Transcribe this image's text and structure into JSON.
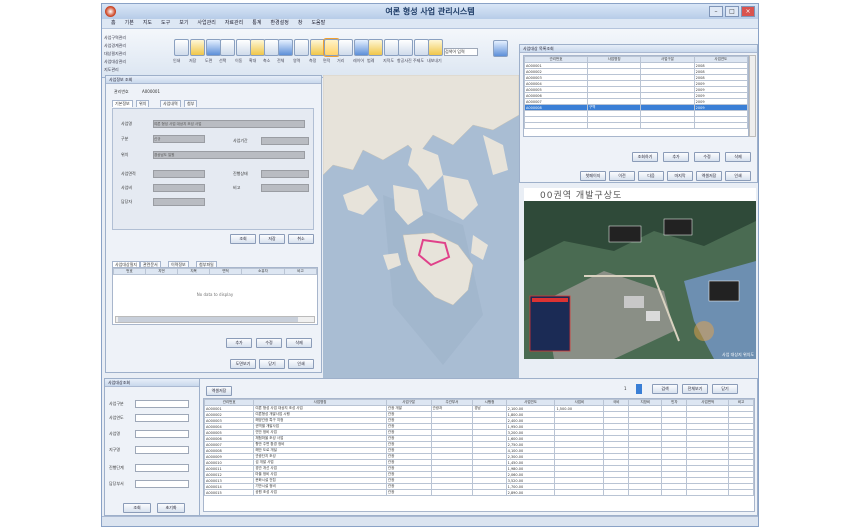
{
  "window": {
    "title": "여론 형성 사업 관리시스템"
  },
  "menu": [
    "홈",
    "기본",
    "지도",
    "도구",
    "보기",
    "사업관리",
    "자료관리",
    "통계",
    "환경설정",
    "창",
    "도움말"
  ],
  "ribbon": {
    "left_items": [
      "사업구역관리",
      "사업경계관리",
      "대상필지관리",
      "사업대상관리",
      "지도관리"
    ],
    "search_box_value": "검색어 입력",
    "icon_labels": [
      "인쇄",
      "저장",
      "도면",
      "선택",
      "이동",
      "확대",
      "축소",
      "전체",
      "영역",
      "측정",
      "면적",
      "거리",
      "레이어",
      "범례",
      "지적도",
      "항공사진",
      "주제도",
      "내보내기"
    ]
  },
  "left_panel": {
    "header": "사업정보 조회",
    "code_label": "관리번호",
    "code_value": "A000001",
    "tabs": [
      "기본정보",
      "위치",
      "사업내역",
      "첨부"
    ],
    "fields": [
      {
        "label": "사업명",
        "value": "여론 형성 사업 대상지 조성 사업"
      },
      {
        "label": "구분",
        "value": "신규"
      },
      {
        "label": "위치",
        "value": "경상남도 일원"
      },
      {
        "label": "사업면적",
        "value": ""
      },
      {
        "label": "사업비",
        "value": ""
      },
      {
        "label": "담당자",
        "value": ""
      }
    ],
    "side_labels": [
      "사업기간",
      "진행상태",
      "비고"
    ],
    "buttons": [
      "조회",
      "저장",
      "취소"
    ],
    "list_tabs": [
      "사업대상필지",
      "관련문서",
      "이력정보",
      "첨부파일"
    ],
    "list_columns": [
      "번호",
      "지번",
      "지목",
      "면적",
      "소유자",
      "비고"
    ],
    "empty_text": "No data to display",
    "list_buttons": [
      "추가",
      "수정",
      "삭제"
    ],
    "bottom_buttons": [
      "도면보기",
      "닫기",
      "인쇄"
    ]
  },
  "right_panel": {
    "header": "사업대상 목록조회",
    "columns": [
      "관리번호",
      "사업명칭",
      "사업구분",
      "사업연도"
    ],
    "rows": [
      [
        "A000001",
        "",
        "",
        "2008"
      ],
      [
        "A000002",
        "",
        "",
        "2008"
      ],
      [
        "A000003",
        "",
        "",
        "2008"
      ],
      [
        "A000004",
        "",
        "",
        "2009"
      ],
      [
        "A000005",
        "",
        "",
        "2009"
      ],
      [
        "A000006",
        "",
        "",
        "2009"
      ],
      [
        "A000007",
        "",
        "",
        "2009"
      ],
      [
        "A000008",
        "구역",
        "",
        "2009"
      ]
    ],
    "selected_row": 7,
    "buttons1": [
      "조회하기",
      "추가",
      "수정",
      "삭제"
    ],
    "buttons2": [
      "첫페이지",
      "이전",
      "다음",
      "마지막",
      "엑셀저장",
      "인쇄"
    ],
    "slogan": "00권역 개발구상도",
    "caption": "사업 대상지 위치도"
  },
  "bottom": {
    "panel_header": "사업대상조회",
    "form_labels": [
      "사업구분",
      "사업연도",
      "사업명",
      "지구명",
      "진행단계",
      "담당부서"
    ],
    "form_buttons": [
      "조회",
      "초기화"
    ],
    "toolbar_button": "엑셀저장",
    "right_buttons": [
      "검색",
      "전체보기",
      "닫기"
    ],
    "page_number": "1",
    "columns": [
      "관리번호",
      "사업명칭",
      "사업구분",
      "주관부서",
      "시행청",
      "사업연도",
      "사업비",
      "국비",
      "지방비",
      "민자",
      "사업면적",
      "비고"
    ],
    "rows": [
      [
        "A000001",
        "여론 형성 사업 대상지 조성 사업",
        "관광 개발",
        "관광과",
        "경남",
        "2,100.00",
        "1,500.00",
        "",
        "",
        "",
        "",
        ""
      ],
      [
        "A000002",
        "여론형성 개발사업 시행",
        "관광",
        "",
        "",
        "1,800.00",
        "",
        "",
        "",
        "",
        "",
        ""
      ],
      [
        "A000003",
        "해양관광 특구 지정",
        "관광",
        "",
        "",
        "2,400.00",
        "",
        "",
        "",
        "",
        "",
        ""
      ],
      [
        "A000004",
        "권역별 개발사업",
        "관광",
        "",
        "",
        "1,950.00",
        "",
        "",
        "",
        "",
        "",
        ""
      ],
      [
        "A000005",
        "연안 정비 사업",
        "관광",
        "",
        "",
        "3,200.00",
        "",
        "",
        "",
        "",
        "",
        ""
      ],
      [
        "A000006",
        "체험마을 조성 사업",
        "관광",
        "",
        "",
        "1,600.00",
        "",
        "",
        "",
        "",
        "",
        ""
      ],
      [
        "A000007",
        "항만 주변 환경 정비",
        "관광",
        "",
        "",
        "2,750.00",
        "",
        "",
        "",
        "",
        "",
        ""
      ],
      [
        "A000008",
        "해안 도로 개설",
        "관광",
        "",
        "",
        "4,100.00",
        "",
        "",
        "",
        "",
        "",
        ""
      ],
      [
        "A000009",
        "관광단지 조성",
        "관광",
        "",
        "",
        "2,300.00",
        "",
        "",
        "",
        "",
        "",
        ""
      ],
      [
        "A000010",
        "섬 개발 사업",
        "관광",
        "",
        "",
        "1,450.00",
        "",
        "",
        "",
        "",
        "",
        ""
      ],
      [
        "A000011",
        "경관 개선 사업",
        "관광",
        "",
        "",
        "1,980.00",
        "",
        "",
        "",
        "",
        "",
        ""
      ],
      [
        "A000012",
        "마을 정비 사업",
        "관광",
        "",
        "",
        "2,060.00",
        "",
        "",
        "",
        "",
        "",
        ""
      ],
      [
        "A000013",
        "문화시설 건립",
        "관광",
        "",
        "",
        "3,520.00",
        "",
        "",
        "",
        "",
        "",
        ""
      ],
      [
        "A000014",
        "기반시설 정비",
        "관광",
        "",
        "",
        "1,700.00",
        "",
        "",
        "",
        "",
        "",
        ""
      ],
      [
        "A000015",
        "공원 조성 사업",
        "관광",
        "",
        "",
        "2,890.00",
        "",
        "",
        "",
        "",
        "",
        ""
      ]
    ]
  },
  "colors": {
    "accent": "#3a7fd6",
    "title": "#1d3b66",
    "highlight": "#e0418a",
    "sea": "#a9bdd3"
  }
}
